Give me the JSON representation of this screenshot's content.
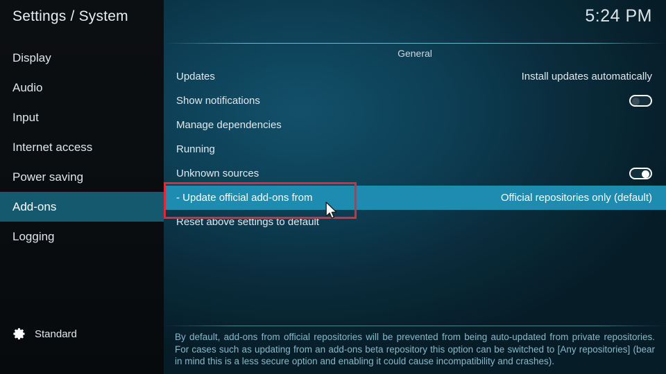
{
  "window": {
    "title": "Settings / System",
    "clock": "5:24 PM"
  },
  "sidebar": {
    "items": [
      {
        "label": "Display",
        "active": false
      },
      {
        "label": "Audio",
        "active": false
      },
      {
        "label": "Input",
        "active": false
      },
      {
        "label": "Internet access",
        "active": false
      },
      {
        "label": "Power saving",
        "active": false
      },
      {
        "label": "Add-ons",
        "active": true
      },
      {
        "label": "Logging",
        "active": false
      }
    ],
    "profile": {
      "icon": "gear-icon",
      "label": "Standard"
    }
  },
  "main": {
    "category": "General",
    "rows": [
      {
        "name": "Updates",
        "kind": "value",
        "value": "Install updates automatically",
        "selected": false
      },
      {
        "name": "Show notifications",
        "kind": "toggle",
        "toggle": "off",
        "selected": false
      },
      {
        "name": "Manage dependencies",
        "kind": "none",
        "selected": false
      },
      {
        "name": "Running",
        "kind": "none",
        "selected": false
      },
      {
        "name": "Unknown sources",
        "kind": "toggle",
        "toggle": "on",
        "selected": false
      },
      {
        "name": "- Update official add-ons from",
        "kind": "value",
        "value": "Official repositories only (default)",
        "selected": true
      },
      {
        "name": "Reset above settings to default",
        "kind": "none",
        "selected": false
      }
    ],
    "help": "By default, add-ons from official repositories will be prevented from being auto-updated from private repositories. For cases such as updating from an add-ons beta repository this option can be switched to [Any repositories] (bear in mind this is a less secure option and enabling it could cause incompatibility and crashes)."
  },
  "annotation": {
    "color": "#e02a39",
    "target": "- Update official add-ons from"
  },
  "colors": {
    "accent_selected_row": "#1e8cb0",
    "accent_sidebar_active": "#14596d",
    "help_text": "#86b9cc",
    "annotation_red": "#e02a39"
  }
}
